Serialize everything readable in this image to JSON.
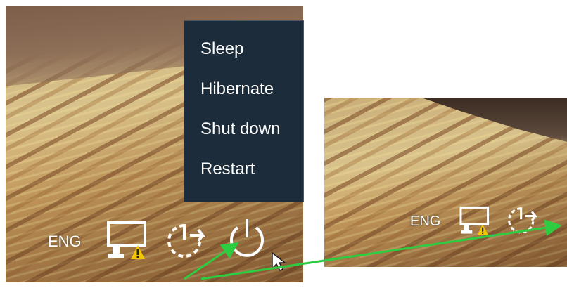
{
  "power_menu": {
    "items": [
      {
        "label": "Sleep"
      },
      {
        "label": "Hibernate"
      },
      {
        "label": "Shut down"
      },
      {
        "label": "Restart"
      }
    ]
  },
  "left_taskbar": {
    "language": "ENG",
    "icons": [
      "network-warning-icon",
      "restart-update-icon",
      "power-icon"
    ]
  },
  "right_taskbar": {
    "language": "ENG",
    "icons": [
      "network-warning-icon",
      "restart-update-icon"
    ]
  },
  "colors": {
    "menu_background": "#1d2c3a",
    "annotation_arrow": "#2ecc40",
    "warning_badge": "#f3c600"
  }
}
